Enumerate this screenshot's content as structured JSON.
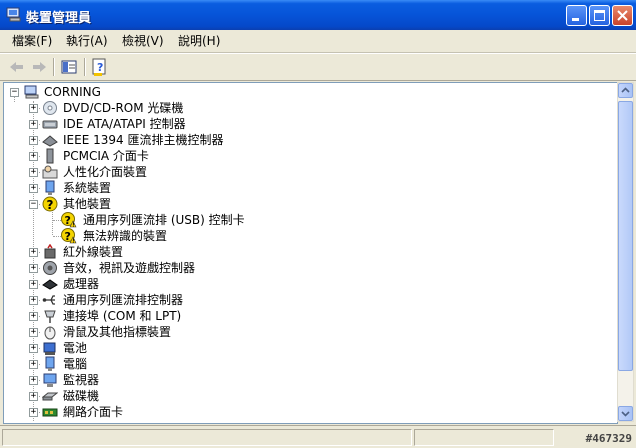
{
  "window": {
    "title": "裝置管理員"
  },
  "menu": [
    {
      "label": "檔案(F)"
    },
    {
      "label": "執行(A)"
    },
    {
      "label": "檢視(V)"
    },
    {
      "label": "說明(H)"
    }
  ],
  "tree": {
    "root": "CORNING",
    "items": [
      {
        "label": "DVD/CD-ROM 光碟機",
        "icon": "cdrom-icon",
        "expander": "+"
      },
      {
        "label": "IDE ATA/ATAPI 控制器",
        "icon": "ide-controller-icon",
        "expander": "+"
      },
      {
        "label": "IEEE 1394 匯流排主機控制器",
        "icon": "firewire-icon",
        "expander": "+"
      },
      {
        "label": "PCMCIA 介面卡",
        "icon": "pcmcia-icon",
        "expander": "+"
      },
      {
        "label": "人性化介面裝置",
        "icon": "hid-icon",
        "expander": "+"
      },
      {
        "label": "系統裝置",
        "icon": "system-device-icon",
        "expander": "+"
      },
      {
        "label": "其他裝置",
        "icon": "unknown-device-icon",
        "expander": "-",
        "children": [
          {
            "label": "通用序列匯流排 (USB) 控制卡",
            "icon": "warning-icon"
          },
          {
            "label": "無法辨識的裝置",
            "icon": "warning-icon"
          }
        ]
      },
      {
        "label": "紅外線裝置",
        "icon": "infrared-icon",
        "expander": "+"
      },
      {
        "label": "音效，視訊及遊戲控制器",
        "icon": "sound-icon",
        "expander": "+"
      },
      {
        "label": "處理器",
        "icon": "processor-icon",
        "expander": "+"
      },
      {
        "label": "通用序列匯流排控制器",
        "icon": "usb-icon",
        "expander": "+"
      },
      {
        "label": "連接埠 (COM 和 LPT)",
        "icon": "port-icon",
        "expander": "+"
      },
      {
        "label": "滑鼠及其他指標裝置",
        "icon": "mouse-icon",
        "expander": "+"
      },
      {
        "label": "電池",
        "icon": "battery-icon",
        "expander": "+"
      },
      {
        "label": "電腦",
        "icon": "computer-icon",
        "expander": "+"
      },
      {
        "label": "監視器",
        "icon": "monitor-icon",
        "expander": "+"
      },
      {
        "label": "磁碟機",
        "icon": "disk-drive-icon",
        "expander": "+"
      },
      {
        "label": "網路介面卡",
        "icon": "network-adapter-icon",
        "expander": "+"
      }
    ]
  },
  "status": {
    "watermark": "#467329"
  },
  "colors": {
    "titlebar": "#0654d8",
    "accent": "#ffd800",
    "window_bg": "#ece9d8"
  }
}
